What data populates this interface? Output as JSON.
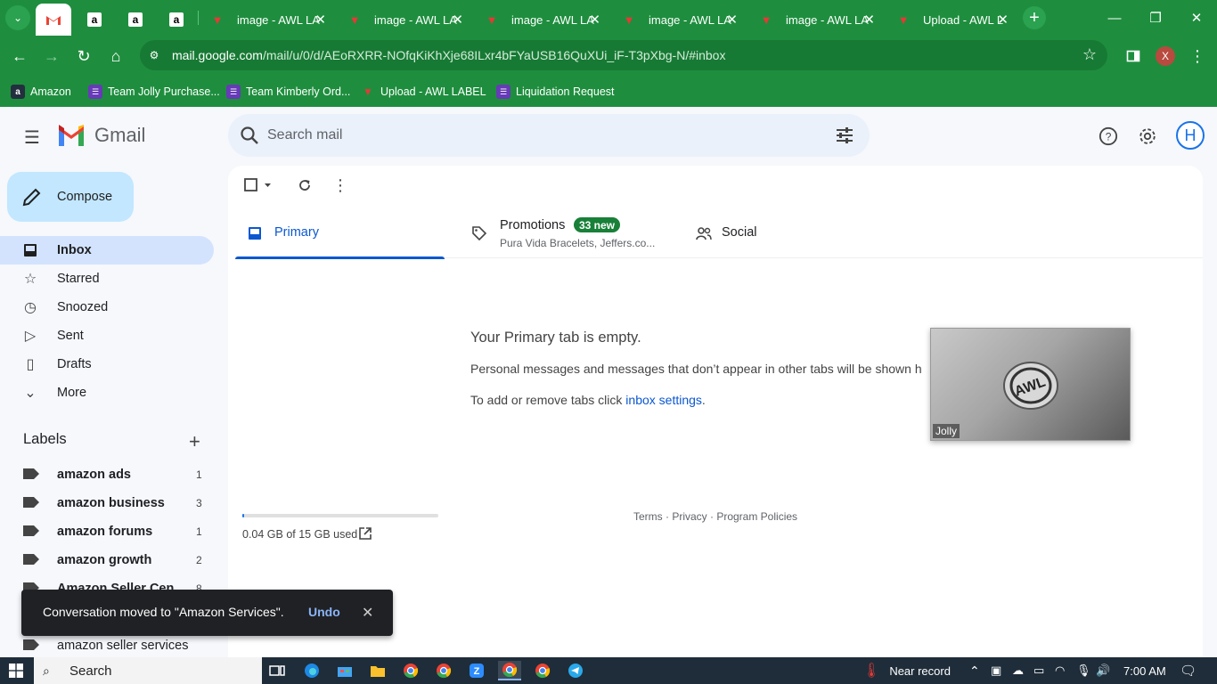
{
  "browser": {
    "tabs": [
      {
        "title": "",
        "favicon": "gmail-icon",
        "active": true
      },
      {
        "title": "",
        "favicon": "amazon-icon"
      },
      {
        "title": "",
        "favicon": "amazon-icon"
      },
      {
        "title": "",
        "favicon": "amazon-icon"
      },
      {
        "title": "image - AWL LA",
        "favicon": "awl-icon"
      },
      {
        "title": "image - AWL LA",
        "favicon": "awl-icon"
      },
      {
        "title": "image - AWL LA",
        "favicon": "awl-icon"
      },
      {
        "title": "image - AWL LA",
        "favicon": "awl-icon"
      },
      {
        "title": "image - AWL LA",
        "favicon": "awl-icon"
      },
      {
        "title": "Upload - AWL L",
        "favicon": "awl-icon"
      }
    ],
    "url_host": "mail.google.com",
    "url_path": "/mail/u/0/d/AEoRXRR-NOfqKiKhXje68ILxr4bFYaUSB16QuXUi_iF-T3pXbg-N/#inbox",
    "profile_initial": "X",
    "bookmarks": [
      {
        "label": "Amazon",
        "icon": "amazon-icon"
      },
      {
        "label": "Team Jolly Purchase...",
        "icon": "list-icon"
      },
      {
        "label": "Team Kimberly Ord...",
        "icon": "list-icon"
      },
      {
        "label": "Upload - AWL LABEL",
        "icon": "awl-icon"
      },
      {
        "label": "Liquidation Request",
        "icon": "list-icon"
      }
    ]
  },
  "gmail": {
    "logo_text": "Gmail",
    "search_placeholder": "Search mail",
    "avatar_initial": "H",
    "compose_label": "Compose",
    "nav": [
      {
        "label": "Inbox",
        "icon": "inbox-icon",
        "active": true
      },
      {
        "label": "Starred",
        "icon": "star-icon"
      },
      {
        "label": "Snoozed",
        "icon": "clock-icon"
      },
      {
        "label": "Sent",
        "icon": "send-icon"
      },
      {
        "label": "Drafts",
        "icon": "draft-icon"
      },
      {
        "label": "More",
        "icon": "chevron-down-icon"
      }
    ],
    "labels_title": "Labels",
    "labels": [
      {
        "name": "amazon ads",
        "count": "1"
      },
      {
        "name": "amazon business",
        "count": "3"
      },
      {
        "name": "amazon forums",
        "count": "1"
      },
      {
        "name": "amazon growth",
        "count": "2"
      },
      {
        "name": "Amazon Seller Cen...",
        "count": "8"
      },
      {
        "name": "",
        "count": ""
      },
      {
        "name": "amazon seller services",
        "count": ""
      }
    ],
    "tabs": {
      "primary": "Primary",
      "promotions": "Promotions",
      "promotions_badge": "33 new",
      "promotions_sub": "Pura Vida Bracelets, Jeffers.co...",
      "social": "Social"
    },
    "empty": {
      "title": "Your Primary tab is empty.",
      "line1": "Personal messages and messages that don’t appear in other tabs will be shown h",
      "line2_prefix": "To add or remove tabs click ",
      "line2_link": "inbox settings",
      "line2_suffix": "."
    },
    "storage": {
      "text": "0.04 GB of 15 GB used",
      "fraction": 0.003
    },
    "footer": "Terms · Privacy · Program Policies",
    "pip_name": "Jolly",
    "snackbar": {
      "message": "Conversation moved to \"Amazon Services\".",
      "action": "Undo"
    }
  },
  "taskbar": {
    "search_label": "Search",
    "weather": "Near record",
    "time": "7:00 AM"
  },
  "colors": {
    "chrome_green": "#1e8e3e",
    "gmail_bg": "#f6f8fc",
    "accent": "#0b57d0",
    "compose": "#c2e7ff"
  }
}
